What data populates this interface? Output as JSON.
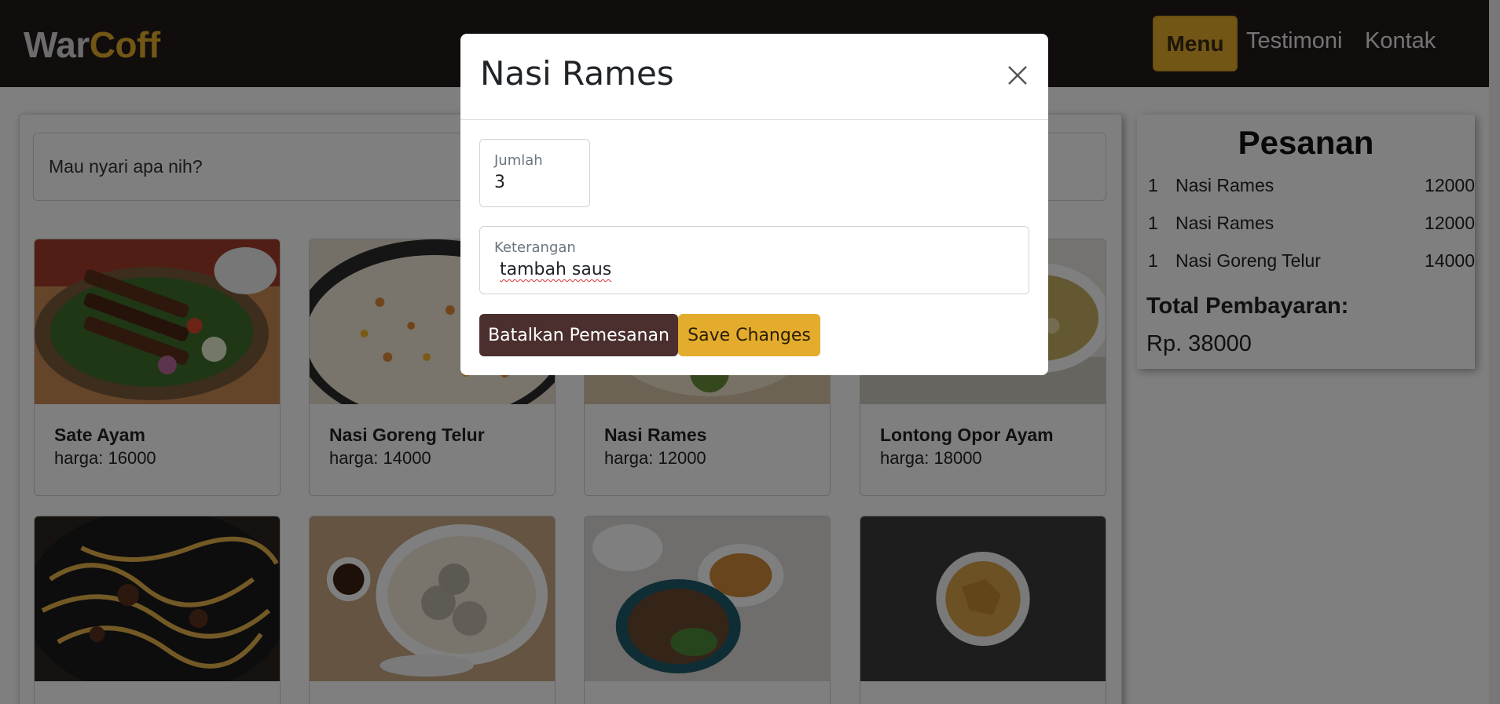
{
  "navbar": {
    "brand_part1": "War",
    "brand_part2": "Coff",
    "links": [
      "Menu",
      "Testimoni",
      "Kontak"
    ],
    "active_link": "Menu"
  },
  "search": {
    "placeholder": "Mau nyari apa nih?"
  },
  "menu_items": [
    {
      "name": "Sate Ayam",
      "price": "harga: 16000"
    },
    {
      "name": "Nasi Goreng Telur",
      "price": "harga: 14000"
    },
    {
      "name": "Nasi Rames",
      "price": "harga: 12000"
    },
    {
      "name": "Lontong Opor Ayam",
      "price": "harga: 18000"
    }
  ],
  "order": {
    "title": "Pesanan",
    "items": [
      {
        "qty": "1",
        "name": "Nasi Rames",
        "price": "12000"
      },
      {
        "qty": "1",
        "name": "Nasi Rames",
        "price": "12000"
      },
      {
        "qty": "1",
        "name": "Nasi Goreng Telur",
        "price": "14000"
      }
    ],
    "total_label": "Total Pembayaran:",
    "total_value": "Rp. 38000"
  },
  "modal": {
    "title": "Nasi Rames",
    "qty_label": "Jumlah",
    "qty_value": "3",
    "note_label": "Keterangan",
    "note_value": "tambah saus",
    "cancel_label": "Batalkan Pemesanan",
    "save_label": "Save Changes"
  },
  "colors": {
    "navbar_bg": "#231a1a",
    "accent": "#e4ac2c",
    "cancel_btn": "#4b2f2f"
  }
}
